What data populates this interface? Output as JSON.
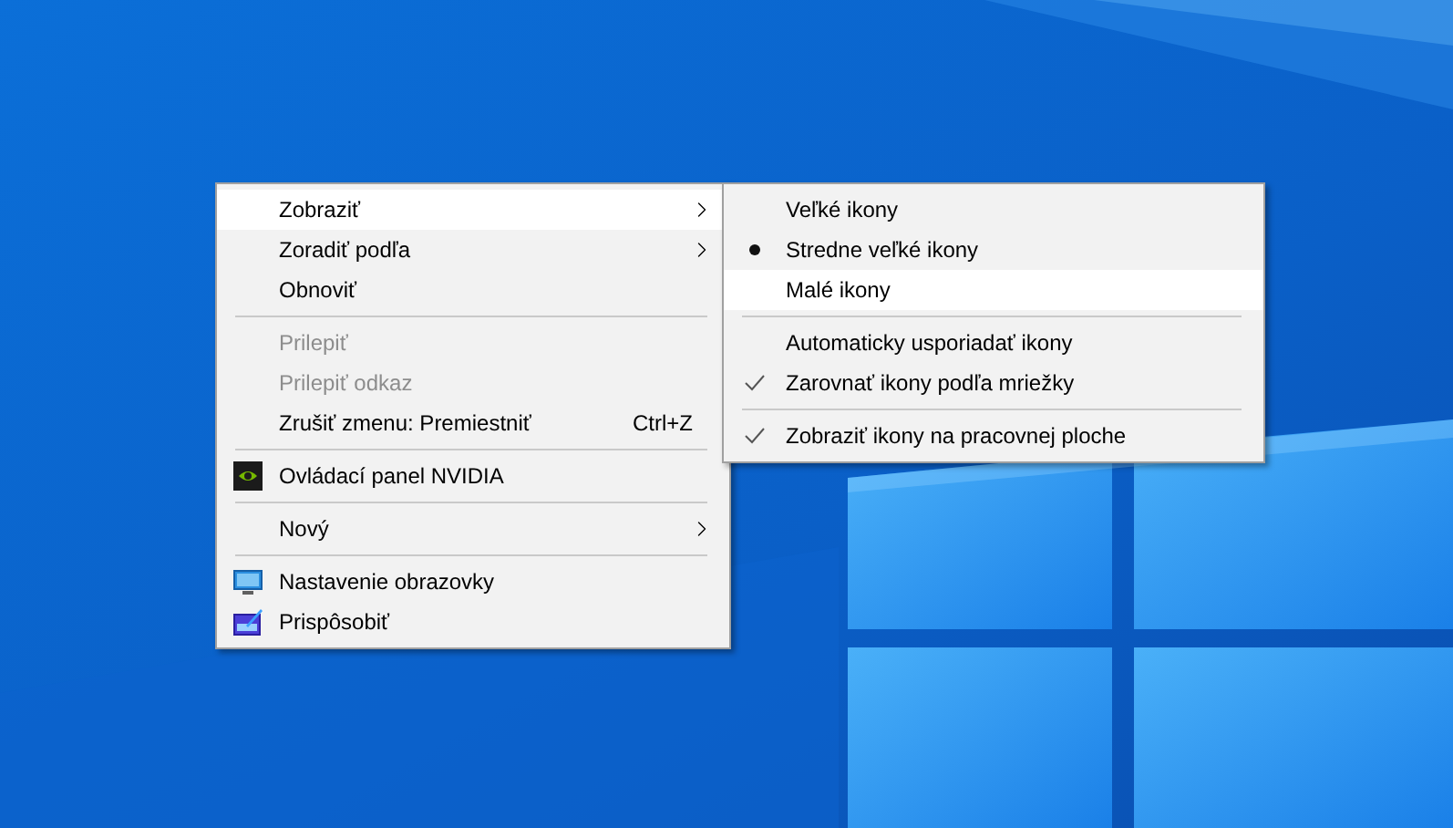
{
  "context_menu": {
    "items": [
      {
        "kind": "plain",
        "label": "Zobraziť",
        "highlighted": true,
        "disabled": false,
        "submenu": true
      },
      {
        "kind": "plain",
        "label": "Zoradiť podľa",
        "highlighted": false,
        "disabled": false,
        "submenu": true
      },
      {
        "kind": "plain",
        "label": "Obnoviť",
        "highlighted": false,
        "disabled": false,
        "submenu": false
      },
      {
        "kind": "separator"
      },
      {
        "kind": "plain",
        "label": "Prilepiť",
        "highlighted": false,
        "disabled": true,
        "submenu": false
      },
      {
        "kind": "plain",
        "label": "Prilepiť odkaz",
        "highlighted": false,
        "disabled": true,
        "submenu": false
      },
      {
        "kind": "plain",
        "label": "Zrušiť zmenu: Premiestniť",
        "shortcut": "Ctrl+Z",
        "highlighted": false,
        "disabled": false,
        "submenu": false
      },
      {
        "kind": "separator"
      },
      {
        "kind": "logo",
        "label": "Ovládací panel NVIDIA",
        "highlighted": false,
        "disabled": false,
        "submenu": false
      },
      {
        "kind": "separator"
      },
      {
        "kind": "plain",
        "label": "Nový",
        "highlighted": false,
        "disabled": false,
        "submenu": true
      },
      {
        "kind": "separator"
      },
      {
        "kind": "display",
        "label": "Nastavenie obrazovky",
        "highlighted": false,
        "disabled": false,
        "submenu": false
      },
      {
        "kind": "personalize",
        "label": "Prispôsobiť",
        "highlighted": false,
        "disabled": false,
        "submenu": false
      }
    ]
  },
  "view_submenu": {
    "items": [
      {
        "kind": "radio",
        "label": "Veľké ikony",
        "selected": false,
        "highlighted": false
      },
      {
        "kind": "radio",
        "label": "Stredne veľké ikony",
        "selected": true,
        "highlighted": false
      },
      {
        "kind": "radio",
        "label": "Malé ikony",
        "selected": false,
        "highlighted": true
      },
      {
        "kind": "separator"
      },
      {
        "kind": "check",
        "label": "Automaticky usporiadať ikony",
        "checked": false,
        "highlighted": false
      },
      {
        "kind": "check",
        "label": "Zarovnať ikony podľa mriežky",
        "checked": true,
        "highlighted": false
      },
      {
        "kind": "separator"
      },
      {
        "kind": "check",
        "label": "Zobraziť ikony na pracovnej ploche",
        "checked": true,
        "highlighted": false
      }
    ]
  }
}
